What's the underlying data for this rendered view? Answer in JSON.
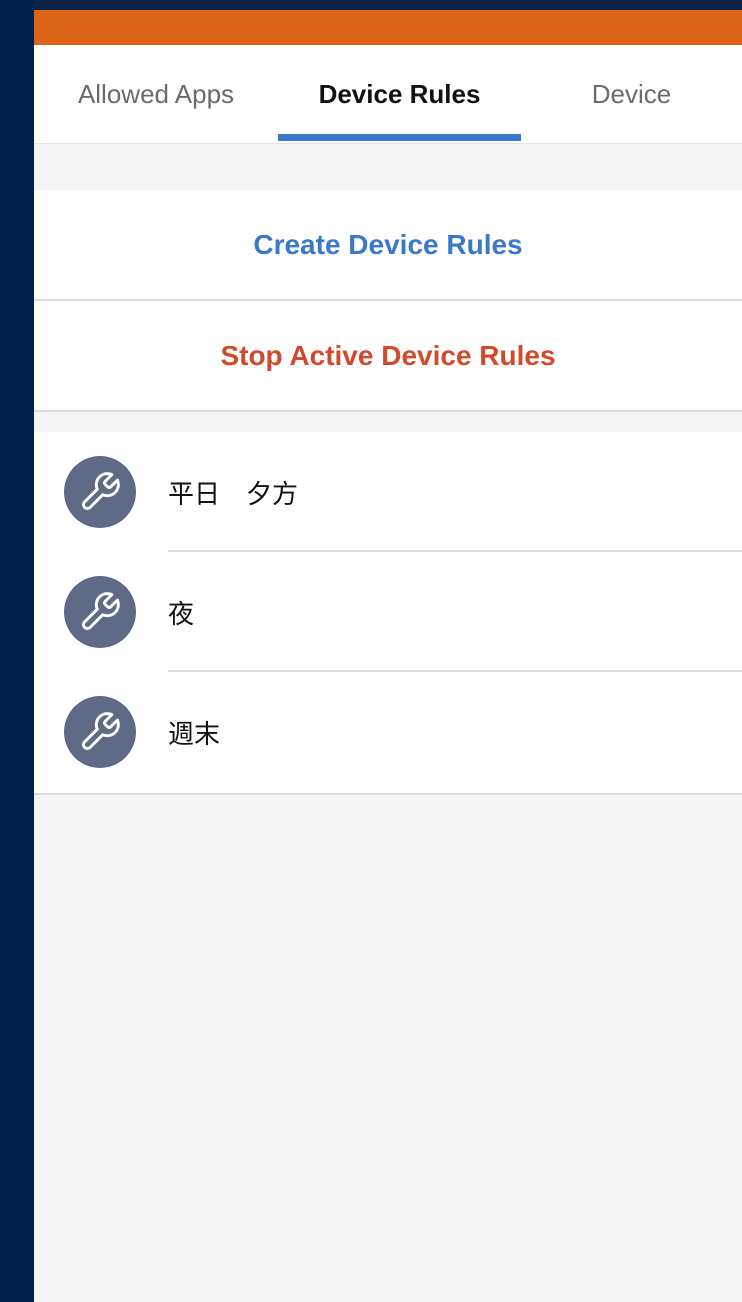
{
  "colors": {
    "accent_blue": "#3a78c9",
    "stop_red": "#d24a2c",
    "header_orange": "#dc6419",
    "icon_circle": "#5f6b86",
    "outer_navy": "#00214d"
  },
  "tabs": [
    {
      "label": "Allowed Apps",
      "selected": false
    },
    {
      "label": "Device Rules",
      "selected": true
    },
    {
      "label": "Device",
      "selected": false
    }
  ],
  "actions": {
    "create_label": "Create Device Rules",
    "stop_label": "Stop Active Device Rules"
  },
  "rules": [
    {
      "name": "平日　夕方",
      "icon": "wrench-icon"
    },
    {
      "name": "夜",
      "icon": "wrench-icon"
    },
    {
      "name": "週末",
      "icon": "wrench-icon"
    }
  ]
}
